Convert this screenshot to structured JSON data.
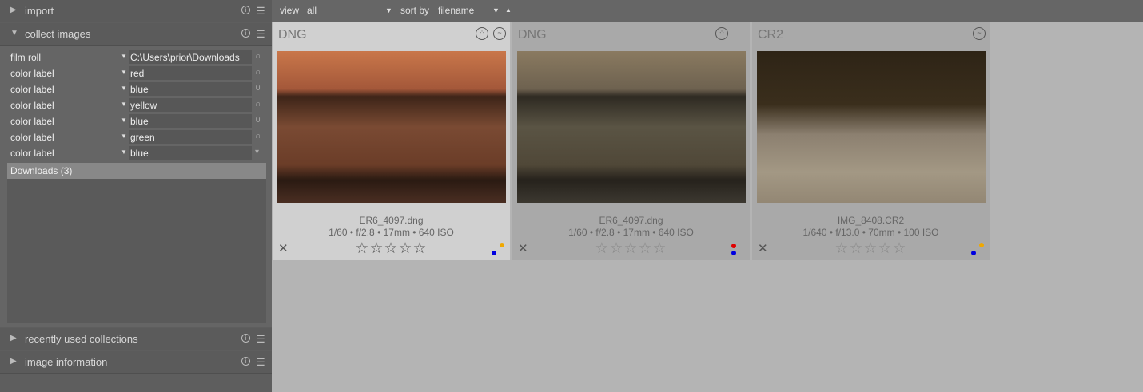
{
  "left_panel": {
    "import": {
      "title": "import"
    },
    "collect": {
      "title": "collect images",
      "rules": [
        {
          "property": "film roll",
          "value": "C:\\Users\\prior\\Downloads",
          "op": "∩"
        },
        {
          "property": "color label",
          "value": "red",
          "op": "∩"
        },
        {
          "property": "color label",
          "value": "blue",
          "op": "∪"
        },
        {
          "property": "color label",
          "value": "yellow",
          "op": "∩"
        },
        {
          "property": "color label",
          "value": "blue",
          "op": "∪"
        },
        {
          "property": "color label",
          "value": "green",
          "op": "∩"
        },
        {
          "property": "color label",
          "value": "blue",
          "op": "▾"
        }
      ],
      "list": [
        "Downloads (3)"
      ]
    },
    "recent": {
      "title": "recently used collections"
    },
    "info": {
      "title": "image information"
    }
  },
  "topbar": {
    "view_label": "view",
    "view_value": "all",
    "sort_label": "sort by",
    "sort_value": "filename"
  },
  "images": [
    {
      "format": "DNG",
      "filename": "ER6_4097.dng",
      "exif": "1/60 • f/2.8 • 17mm • 640 ISO",
      "labels": [
        "#f0a800",
        "#0000e0"
      ],
      "selected": true
    },
    {
      "format": "DNG",
      "filename": "ER6_4097.dng",
      "exif": "1/60 • f/2.8 • 17mm • 640 ISO",
      "labels": [
        "#e00000",
        "#0000e0"
      ],
      "selected": false
    },
    {
      "format": "CR2",
      "filename": "IMG_8408.CR2",
      "exif": "1/640 • f/13.0 • 70mm • 100 ISO",
      "labels": [
        "#f0a800",
        "#0000e0"
      ],
      "selected": false
    }
  ],
  "colors": {
    "selected_card": "#d0d0d0",
    "card": "#a9a9a9"
  }
}
